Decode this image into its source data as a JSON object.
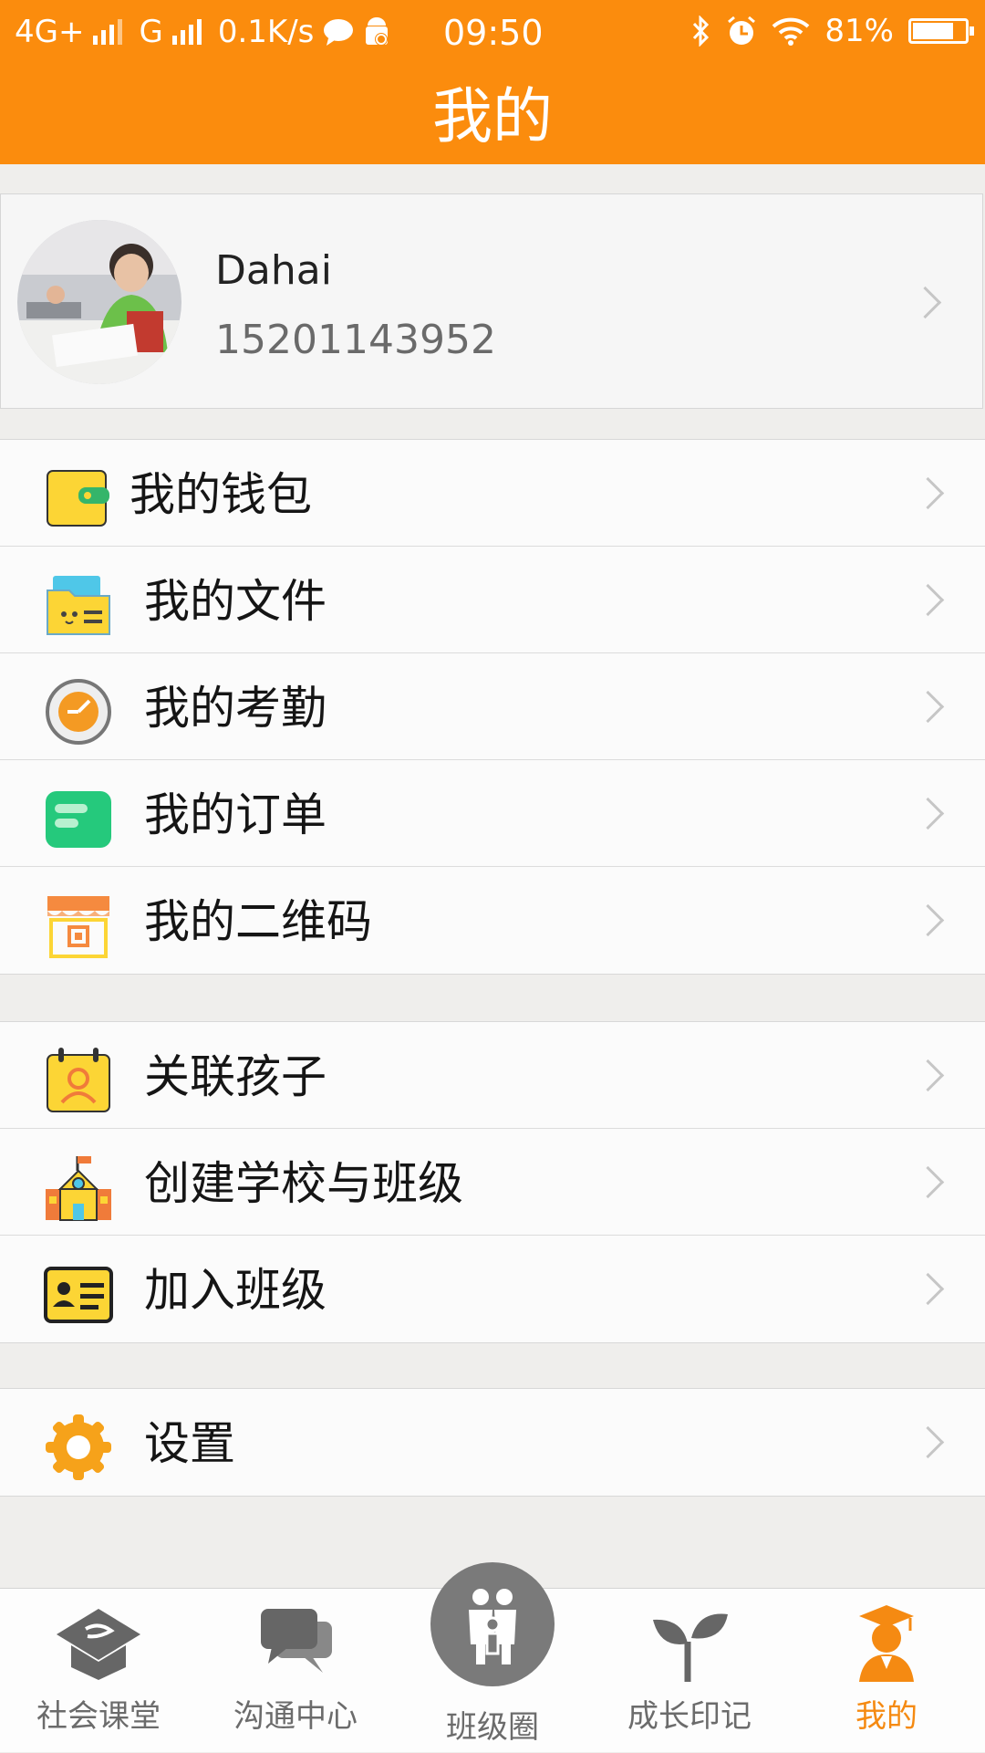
{
  "status_bar": {
    "network1": "4G+",
    "network2": "G",
    "speed": "0.1K/s",
    "time": "09:50",
    "battery_percent": "81%",
    "battery_level": 0.81
  },
  "header": {
    "title": "我的"
  },
  "profile": {
    "name": "Dahai",
    "phone": "15201143952"
  },
  "menu_groups": [
    {
      "items": [
        {
          "label": "我的钱包",
          "icon": "wallet-icon"
        },
        {
          "label": "我的文件",
          "icon": "folder-icon"
        },
        {
          "label": "我的考勤",
          "icon": "clock-icon"
        },
        {
          "label": "我的订单",
          "icon": "order-icon"
        },
        {
          "label": "我的二维码",
          "icon": "store-qrcode-icon"
        }
      ]
    },
    {
      "items": [
        {
          "label": "关联孩子",
          "icon": "child-card-icon"
        },
        {
          "label": "创建学校与班级",
          "icon": "school-icon"
        },
        {
          "label": "加入班级",
          "icon": "id-card-icon"
        }
      ]
    },
    {
      "items": [
        {
          "label": "设置",
          "icon": "gear-icon"
        }
      ]
    }
  ],
  "tabs": [
    {
      "label": "社会课堂",
      "icon": "graduation-icon",
      "active": false
    },
    {
      "label": "沟通中心",
      "icon": "chat-icon",
      "active": false
    },
    {
      "label": "班级圈",
      "icon": "family-icon",
      "active": false
    },
    {
      "label": "成长印记",
      "icon": "sprout-icon",
      "active": false
    },
    {
      "label": "我的",
      "icon": "student-icon",
      "active": true
    }
  ],
  "colors": {
    "accent": "#fb8c0d",
    "active_tab": "#f58a12",
    "background": "#efeeec"
  }
}
